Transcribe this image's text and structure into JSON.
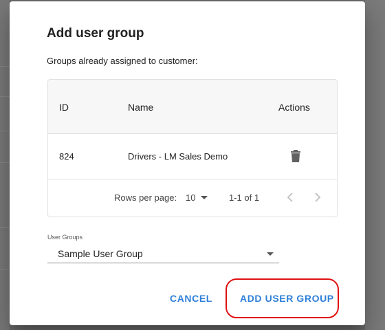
{
  "dialog": {
    "title": "Add user group",
    "subtitle": "Groups already assigned to customer:"
  },
  "table": {
    "columns": {
      "id": "ID",
      "name": "Name",
      "actions": "Actions"
    },
    "rows": [
      {
        "id": "824",
        "name": "Drivers - LM Sales Demo",
        "action_icon": "trash-icon"
      }
    ],
    "pagination": {
      "rows_per_page_label": "Rows per page:",
      "rows_per_page": "10",
      "range": "1-1 of 1"
    }
  },
  "user_groups_select": {
    "label": "User Groups",
    "value": "Sample User Group"
  },
  "actions": {
    "cancel": "CANCEL",
    "add": "ADD USER GROUP"
  },
  "colors": {
    "accent": "#2f7fd9",
    "highlight": "#e01010"
  }
}
